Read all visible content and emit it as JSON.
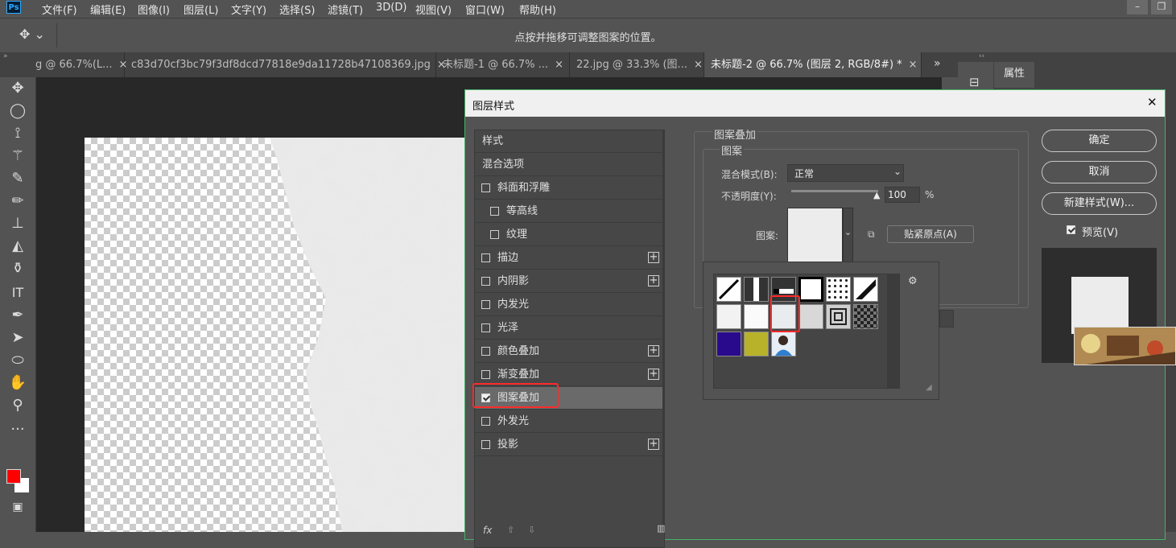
{
  "app": {
    "logo": "Ps"
  },
  "menu": [
    "文件(F)",
    "编辑(E)",
    "图像(I)",
    "图层(L)",
    "文字(Y)",
    "选择(S)",
    "滤镜(T)",
    "3D(D)",
    "视图(V)",
    "窗口(W)",
    "帮助(H)"
  ],
  "options": {
    "hint": "点按并拖移可调整图案的位置。",
    "move_glyph": "✥ ⌄"
  },
  "tabs": [
    {
      "label": "g @ 66.7%(L...",
      "close": "×"
    },
    {
      "label": "c83d70cf3bc79f3df8dcd77818e9da11728b47108369.jpg",
      "close": "×"
    },
    {
      "label": "未标题-1 @ 66.7% ...",
      "close": "×"
    },
    {
      "label": "22.jpg @ 33.3% (图...",
      "close": "×"
    },
    {
      "label": "未标题-2 @ 66.7% (图层 2, RGB/8#) *",
      "close": "×"
    }
  ],
  "tab_overflow": "»",
  "right_panel": {
    "tab_label": "属性",
    "collapse": "‹‹",
    "side_icon": "⊟"
  },
  "dialog": {
    "title": "图层样式",
    "close": "✕",
    "styles": [
      {
        "label": "样式",
        "checkbox": false,
        "checked": false,
        "plus": false,
        "indent": 0
      },
      {
        "label": "混合选项",
        "checkbox": false,
        "checked": false,
        "plus": false,
        "indent": 0
      },
      {
        "label": "斜面和浮雕",
        "checkbox": true,
        "checked": false,
        "plus": false,
        "indent": 0
      },
      {
        "label": "等高线",
        "checkbox": true,
        "checked": false,
        "plus": false,
        "indent": 1
      },
      {
        "label": "纹理",
        "checkbox": true,
        "checked": false,
        "plus": false,
        "indent": 1
      },
      {
        "label": "描边",
        "checkbox": true,
        "checked": false,
        "plus": true,
        "indent": 0
      },
      {
        "label": "内阴影",
        "checkbox": true,
        "checked": false,
        "plus": true,
        "indent": 0
      },
      {
        "label": "内发光",
        "checkbox": true,
        "checked": false,
        "plus": false,
        "indent": 0
      },
      {
        "label": "光泽",
        "checkbox": true,
        "checked": false,
        "plus": false,
        "indent": 0
      },
      {
        "label": "颜色叠加",
        "checkbox": true,
        "checked": false,
        "plus": true,
        "indent": 0
      },
      {
        "label": "渐变叠加",
        "checkbox": true,
        "checked": false,
        "plus": true,
        "indent": 0
      },
      {
        "label": "图案叠加",
        "checkbox": true,
        "checked": true,
        "plus": false,
        "indent": 0,
        "selected": true
      },
      {
        "label": "外发光",
        "checkbox": true,
        "checked": false,
        "plus": false,
        "indent": 0
      },
      {
        "label": "投影",
        "checkbox": true,
        "checked": false,
        "plus": true,
        "indent": 0
      }
    ],
    "list_footer": {
      "fx": "fx",
      "up": "⇧",
      "down": "⇩",
      "trash": "🗑"
    },
    "section_title": "图案叠加",
    "group_title": "图案",
    "blend_label": "混合模式(B):",
    "blend_value": "正常",
    "opacity_label": "不透明度(Y):",
    "opacity_value": "100",
    "opacity_unit": "%",
    "opacity_level": 1.0,
    "pattern_label": "图案:",
    "snap_button": "贴紧原点(A)",
    "buttons": {
      "ok": "确定",
      "cancel": "取消",
      "new_style": "新建样式(W)...",
      "preview": "预览(V)"
    },
    "preview_checked": true,
    "picker_gear": "⚙"
  },
  "colors": {
    "accent_green": "#47b06a",
    "highlight_red": "#ff2a2a",
    "foreground": "#ff0000",
    "background": "#ffffff"
  }
}
